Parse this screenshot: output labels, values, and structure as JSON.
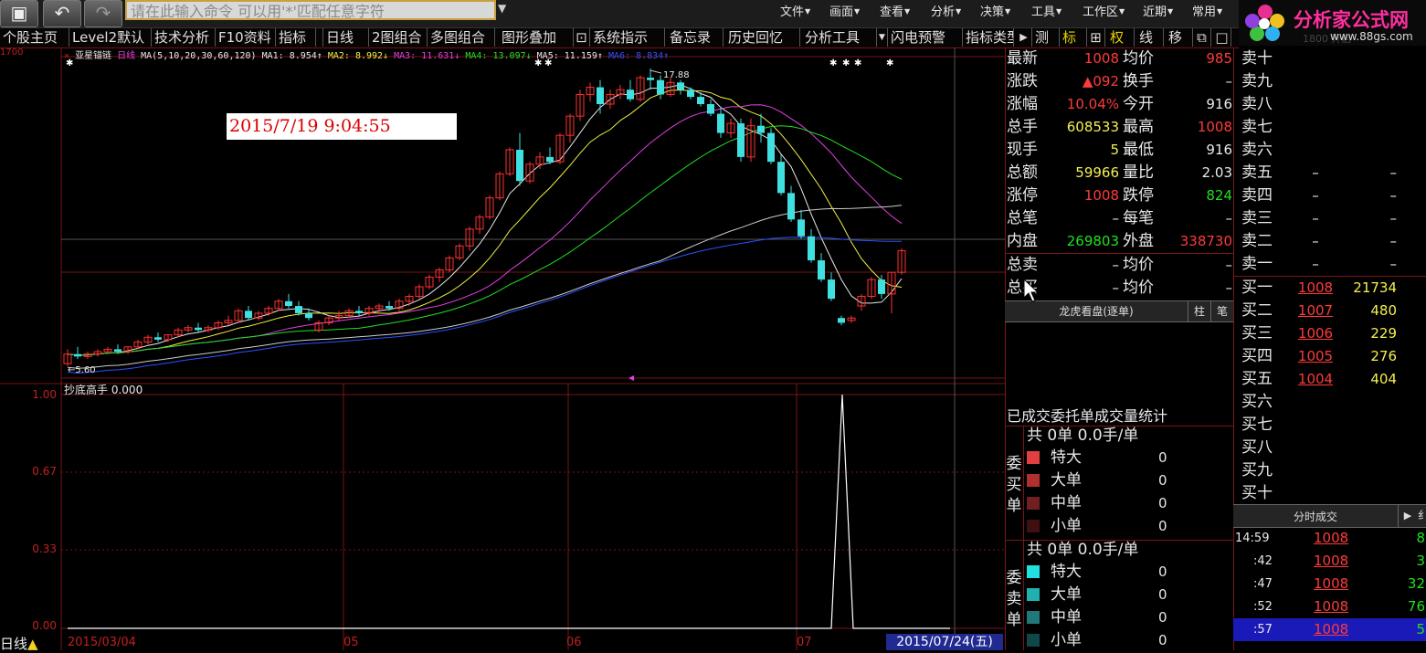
{
  "topbar": {
    "command_placeholder": "请在此输入命令  可以用'*'匹配任意字符",
    "menus": [
      "文件",
      "画面",
      "查看",
      "分析",
      "决策",
      "工具",
      "工作区",
      "近期",
      "常用"
    ],
    "logo_text": "分析家公式网",
    "logo_url": "www.88gs.com",
    "logo_bg_text": "1800 开启"
  },
  "toolbar": {
    "tabs": [
      "个股主页",
      "Level2默认",
      "技术分析",
      "F10资料",
      "指标",
      "日线",
      "2图组合",
      "多图组合",
      "图形叠加",
      "系统指示",
      "备忘录",
      "历史回忆",
      "分析工具",
      "闪电预警",
      "指标类型"
    ],
    "right_items": [
      "测",
      "标",
      "权",
      "线",
      "移"
    ]
  },
  "chart": {
    "stock_name": "亚星锚链",
    "period": "日线",
    "ma_param": "MA(5,10,20,30,60,120)",
    "ma_values": [
      {
        "label": "MA1:",
        "value": "8.954↑",
        "color": "#e8e8e8"
      },
      {
        "label": "MA2:",
        "value": "8.992↓",
        "color": "#f0f040"
      },
      {
        "label": "MA3:",
        "value": "11.631↓",
        "color": "#e040e0"
      },
      {
        "label": "MA4:",
        "value": "13.097↓",
        "color": "#20e020"
      },
      {
        "label": "MA5:",
        "value": "11.159↑",
        "color": "#e8e8e8"
      },
      {
        "label": "MA6:",
        "value": "8.834↑",
        "color": "#3050ff"
      }
    ],
    "timestamp": "2015/7/19 9:04:55",
    "high_marker": "17.88",
    "low_marker": "5.60",
    "top_axis_label": "1700",
    "indicator_name": "抄底高手",
    "indicator_value": "0.000",
    "indicator_yticks": [
      "1.00",
      "0.67",
      "0.33",
      "0.00"
    ],
    "x_labels": [
      "2015/03/04",
      "05",
      "06",
      "07"
    ],
    "current_date": "2015/07/24(五)",
    "status_label": "日线",
    "candles": [
      [
        5.6,
        6.2,
        5.5,
        6.0
      ],
      [
        6.0,
        6.3,
        5.8,
        5.9
      ],
      [
        5.9,
        6.1,
        5.8,
        6.0
      ],
      [
        6.0,
        6.2,
        5.9,
        6.1
      ],
      [
        6.1,
        6.3,
        6.0,
        6.2
      ],
      [
        6.2,
        6.4,
        6.0,
        6.1
      ],
      [
        6.1,
        6.3,
        6.0,
        6.3
      ],
      [
        6.3,
        6.6,
        6.2,
        6.5
      ],
      [
        6.5,
        6.8,
        6.4,
        6.7
      ],
      [
        6.7,
        6.9,
        6.5,
        6.6
      ],
      [
        6.6,
        6.8,
        6.5,
        6.8
      ],
      [
        6.8,
        7.1,
        6.7,
        7.0
      ],
      [
        7.0,
        7.2,
        6.9,
        7.1
      ],
      [
        7.1,
        7.3,
        6.9,
        7.0
      ],
      [
        7.0,
        7.2,
        6.9,
        7.1
      ],
      [
        7.1,
        7.4,
        7.0,
        7.3
      ],
      [
        7.3,
        7.6,
        7.2,
        7.4
      ],
      [
        7.4,
        7.9,
        7.3,
        7.8
      ],
      [
        7.8,
        8.0,
        7.4,
        7.5
      ],
      [
        7.5,
        7.8,
        7.4,
        7.7
      ],
      [
        7.7,
        8.0,
        7.6,
        7.9
      ],
      [
        7.9,
        8.3,
        7.8,
        8.2
      ],
      [
        8.2,
        8.5,
        7.9,
        8.0
      ],
      [
        8.0,
        8.2,
        7.6,
        7.7
      ],
      [
        7.7,
        7.9,
        7.4,
        7.5
      ],
      [
        7.0,
        7.4,
        6.9,
        7.3
      ],
      [
        7.3,
        7.6,
        7.2,
        7.5
      ],
      [
        7.5,
        7.8,
        7.4,
        7.6
      ],
      [
        7.6,
        7.9,
        7.5,
        7.8
      ],
      [
        7.8,
        8.0,
        7.6,
        7.7
      ],
      [
        7.7,
        8.0,
        7.6,
        7.9
      ],
      [
        7.9,
        8.1,
        7.7,
        8.0
      ],
      [
        8.0,
        8.2,
        7.8,
        7.9
      ],
      [
        7.9,
        8.3,
        7.8,
        8.2
      ],
      [
        8.2,
        8.5,
        8.0,
        8.4
      ],
      [
        8.4,
        8.9,
        8.3,
        8.8
      ],
      [
        8.8,
        9.3,
        8.7,
        9.2
      ],
      [
        9.2,
        9.6,
        9.0,
        9.5
      ],
      [
        9.5,
        10.1,
        9.4,
        10.0
      ],
      [
        10.0,
        10.6,
        9.9,
        10.5
      ],
      [
        10.5,
        11.3,
        10.3,
        11.2
      ],
      [
        11.2,
        11.8,
        11.0,
        11.7
      ],
      [
        11.7,
        12.6,
        11.6,
        12.5
      ],
      [
        12.5,
        13.6,
        12.4,
        13.5
      ],
      [
        13.5,
        14.6,
        13.4,
        14.5
      ],
      [
        14.5,
        15.2,
        13.0,
        13.2
      ],
      [
        13.2,
        14.0,
        13.1,
        13.9
      ],
      [
        13.9,
        14.4,
        13.7,
        14.2
      ],
      [
        14.2,
        14.6,
        13.9,
        14.0
      ],
      [
        14.0,
        15.2,
        13.9,
        15.1
      ],
      [
        15.1,
        16.0,
        14.8,
        15.9
      ],
      [
        15.9,
        17.0,
        15.7,
        16.8
      ],
      [
        16.8,
        17.3,
        16.5,
        17.1
      ],
      [
        17.1,
        17.4,
        16.0,
        16.4
      ],
      [
        16.4,
        17.0,
        16.2,
        16.8
      ],
      [
        16.8,
        17.2,
        16.6,
        17.0
      ],
      [
        17.0,
        17.4,
        16.5,
        16.6
      ],
      [
        16.6,
        17.6,
        16.5,
        17.5
      ],
      [
        17.5,
        17.88,
        17.0,
        17.4
      ],
      [
        17.4,
        17.6,
        16.6,
        16.8
      ],
      [
        16.8,
        17.5,
        16.7,
        17.3
      ],
      [
        17.3,
        17.4,
        16.8,
        17.0
      ],
      [
        17.0,
        17.1,
        16.6,
        16.7
      ],
      [
        16.7,
        16.9,
        16.3,
        16.4
      ],
      [
        16.4,
        16.6,
        15.9,
        16.0
      ],
      [
        16.0,
        16.3,
        15.0,
        15.2
      ],
      [
        15.2,
        15.8,
        15.0,
        15.6
      ],
      [
        15.6,
        15.8,
        14.0,
        14.2
      ],
      [
        14.2,
        15.8,
        14.0,
        15.5
      ],
      [
        15.5,
        16.0,
        14.8,
        15.2
      ],
      [
        15.2,
        15.4,
        13.9,
        14.0
      ],
      [
        14.0,
        14.3,
        12.6,
        12.7
      ],
      [
        12.7,
        13.0,
        11.5,
        11.6
      ],
      [
        11.6,
        12.0,
        10.8,
        10.9
      ],
      [
        10.9,
        11.2,
        9.8,
        9.9
      ],
      [
        9.9,
        10.2,
        9.0,
        9.1
      ],
      [
        9.1,
        9.4,
        8.2,
        8.3
      ],
      [
        7.5,
        7.6,
        7.2,
        7.3
      ],
      [
        7.4,
        7.6,
        7.3,
        7.5
      ],
      [
        8.0,
        8.5,
        7.8,
        8.4
      ],
      [
        8.4,
        9.2,
        8.3,
        9.1
      ],
      [
        9.1,
        9.3,
        8.3,
        8.5
      ],
      [
        8.5,
        9.4,
        7.7,
        9.4
      ],
      [
        9.4,
        10.4,
        9.3,
        10.3
      ]
    ]
  },
  "quote": {
    "rows": [
      {
        "l1": "最新",
        "v1": "1008",
        "c1": "cr",
        "l2": "均价",
        "v2": "985",
        "c2": "cr"
      },
      {
        "l1": "涨跌",
        "v1": "▲092",
        "c1": "cr",
        "l2": "换手",
        "v2": "–",
        "c2": "cw"
      },
      {
        "l1": "涨幅",
        "v1": "10.04%",
        "c1": "cr",
        "l2": "今开",
        "v2": "916",
        "c2": "cw"
      },
      {
        "l1": "总手",
        "v1": "608533",
        "c1": "cy",
        "l2": "最高",
        "v2": "1008",
        "c2": "cr"
      },
      {
        "l1": "现手",
        "v1": "5",
        "c1": "cy",
        "l2": "最低",
        "v2": "916",
        "c2": "cw"
      },
      {
        "l1": "总额",
        "v1": "59966",
        "c1": "cy",
        "l2": "量比",
        "v2": "2.03",
        "c2": "cw"
      },
      {
        "l1": "涨停",
        "v1": "1008",
        "c1": "cr",
        "l2": "跌停",
        "v2": "824",
        "c2": "cg"
      },
      {
        "l1": "总笔",
        "v1": "–",
        "c1": "cw",
        "l2": "每笔",
        "v2": "–",
        "c2": "cw"
      },
      {
        "l1": "内盘",
        "v1": "269803",
        "c1": "cg",
        "l2": "外盘",
        "v2": "338730",
        "c2": "cr"
      },
      {
        "l1": "总卖",
        "v1": "–",
        "c1": "cw",
        "l2": "均价",
        "v2": "–",
        "c2": "cw"
      },
      {
        "l1": "总买",
        "v1": "–",
        "c1": "cw",
        "l2": "均价",
        "v2": "–",
        "c2": "cw"
      }
    ],
    "dragon_title": "龙虎看盘(逐单)",
    "dragon_btn1": "柱",
    "dragon_btn2": "笔",
    "flow_title": "已成交委托单成交量统计",
    "buy_section": {
      "label": "委买单",
      "summary": "共 0单 0.0手/单",
      "rows": [
        {
          "name": "特大",
          "value": "0",
          "color": "#e04040"
        },
        {
          "name": "大单",
          "value": "0",
          "color": "#b03030"
        },
        {
          "name": "中单",
          "value": "0",
          "color": "#702020"
        },
        {
          "name": "小单",
          "value": "0",
          "color": "#401010"
        }
      ]
    },
    "sell_section": {
      "label": "委卖单",
      "summary": "共 0单 0.0手/单",
      "rows": [
        {
          "name": "特大",
          "value": "0",
          "color": "#20e0e0"
        },
        {
          "name": "大单",
          "value": "0",
          "color": "#20b0b0"
        },
        {
          "name": "中单",
          "value": "0",
          "color": "#207878"
        },
        {
          "name": "小单",
          "value": "0",
          "color": "#104848"
        }
      ]
    }
  },
  "book": {
    "rows": [
      {
        "label": "卖十",
        "price": "",
        "vol": ""
      },
      {
        "label": "卖九",
        "price": "",
        "vol": ""
      },
      {
        "label": "卖八",
        "price": "",
        "vol": ""
      },
      {
        "label": "卖七",
        "price": "",
        "vol": ""
      },
      {
        "label": "卖六",
        "price": "",
        "vol": ""
      },
      {
        "label": "卖五",
        "price": "–",
        "vol": "–"
      },
      {
        "label": "卖四",
        "price": "–",
        "vol": "–"
      },
      {
        "label": "卖三",
        "price": "–",
        "vol": "–"
      },
      {
        "label": "卖二",
        "price": "–",
        "vol": "–"
      },
      {
        "label": "卖一",
        "price": "–",
        "vol": "–"
      },
      {
        "label": "买一",
        "price": "1008",
        "vol": "21734"
      },
      {
        "label": "买二",
        "price": "1007",
        "vol": "480"
      },
      {
        "label": "买三",
        "price": "1006",
        "vol": "229"
      },
      {
        "label": "买四",
        "price": "1005",
        "vol": "276"
      },
      {
        "label": "买五",
        "price": "1004",
        "vol": "404"
      },
      {
        "label": "买六",
        "price": "",
        "vol": ""
      },
      {
        "label": "买七",
        "price": "",
        "vol": ""
      },
      {
        "label": "买八",
        "price": "",
        "vol": ""
      },
      {
        "label": "买九",
        "price": "",
        "vol": ""
      },
      {
        "label": "买十",
        "price": "",
        "vol": ""
      }
    ],
    "ticks_title": "分时成交",
    "ticks_right": "纟",
    "ticks": [
      {
        "time": "14:59",
        "price": "1008",
        "vol": "8"
      },
      {
        "time": ":42",
        "price": "1008",
        "vol": "3"
      },
      {
        "time": ":47",
        "price": "1008",
        "vol": "32"
      },
      {
        "time": ":52",
        "price": "1008",
        "vol": "76"
      },
      {
        "time": ":57",
        "price": "1008",
        "vol": "5"
      }
    ]
  }
}
